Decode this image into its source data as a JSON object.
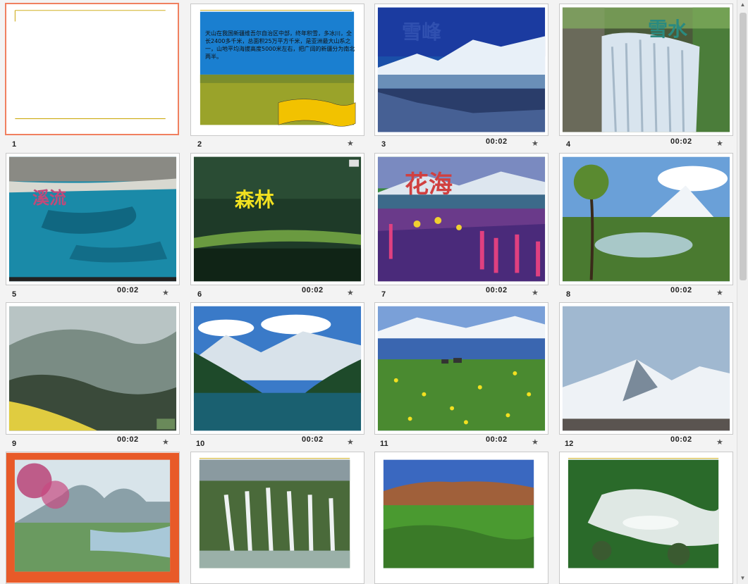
{
  "slides": [
    {
      "num": "1",
      "duration": "",
      "title": ""
    },
    {
      "num": "2",
      "duration": "",
      "title": "",
      "para": "天山在我国新疆维吾尔自治区中部，终年积雪，多冰川，全长2400多千米，总面积25万平方千米，是亚洲最大山系之一，山地平均海拔高度5000米左右，把广阔的新疆分为南北两半。"
    },
    {
      "num": "3",
      "duration": "00:02",
      "title": "雪峰"
    },
    {
      "num": "4",
      "duration": "00:02",
      "title": "雪水"
    },
    {
      "num": "5",
      "duration": "00:02",
      "title": "溪流"
    },
    {
      "num": "6",
      "duration": "00:02",
      "title": "森林"
    },
    {
      "num": "7",
      "duration": "00:02",
      "title": "花海"
    },
    {
      "num": "8",
      "duration": "00:02",
      "title": ""
    },
    {
      "num": "9",
      "duration": "00:02",
      "title": ""
    },
    {
      "num": "10",
      "duration": "00:02",
      "title": ""
    },
    {
      "num": "11",
      "duration": "00:02",
      "title": ""
    },
    {
      "num": "12",
      "duration": "00:02",
      "title": ""
    },
    {
      "num": "",
      "duration": "",
      "title": ""
    },
    {
      "num": "",
      "duration": "",
      "title": ""
    },
    {
      "num": "",
      "duration": "",
      "title": ""
    },
    {
      "num": "",
      "duration": "",
      "title": ""
    }
  ],
  "icons": {
    "transition": "star-icon",
    "animation": "animation-icon"
  },
  "colors": {
    "selected_border": "#f08060",
    "background": "#f3f3f3"
  }
}
